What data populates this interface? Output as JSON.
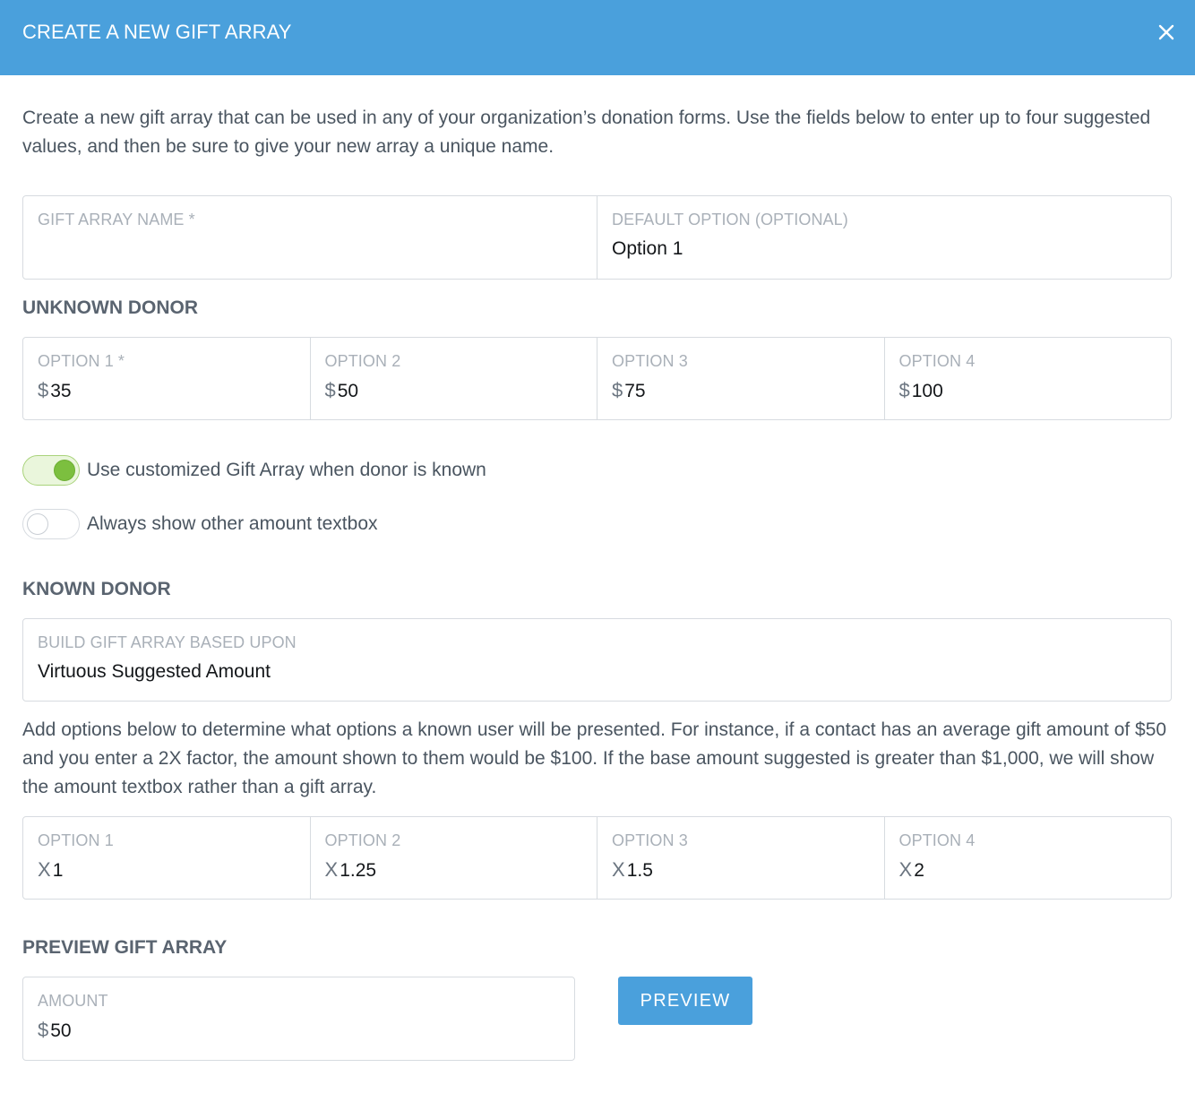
{
  "header": {
    "title": "CREATE A NEW GIFT ARRAY",
    "close_icon": "close-icon"
  },
  "intro": "Create a new gift array that can be used in any of your organization’s donation forms. Use the fields below to enter up to four suggested values, and then be sure to give your new array a unique name.",
  "array_fields": {
    "name_label": "GIFT ARRAY NAME *",
    "name_value": "",
    "default_label": "DEFAULT OPTION (OPTIONAL)",
    "default_value": "Option 1"
  },
  "unknown_donor": {
    "title": "UNKNOWN DONOR",
    "currency_symbol": "$",
    "options": [
      {
        "label": "OPTION 1 *",
        "value": "35"
      },
      {
        "label": "OPTION 2",
        "value": "50"
      },
      {
        "label": "OPTION 3",
        "value": "75"
      },
      {
        "label": "OPTION 4",
        "value": "100"
      }
    ]
  },
  "toggles": [
    {
      "label": "Use customized Gift Array when donor is known",
      "on": true
    },
    {
      "label": "Always show other amount textbox",
      "on": false
    }
  ],
  "known_donor": {
    "title": "KNOWN DONOR",
    "basis_label": "BUILD GIFT ARRAY BASED UPON",
    "basis_value": "Virtuous Suggested Amount",
    "help": "Add options below to determine what options a known user will be presented. For instance, if a contact has an average gift amount of $50 and you enter a 2X factor, the amount shown to them would be $100. If the base amount suggested is greater than $1,000, we will show the amount textbox rather than a gift array.",
    "multiplier_symbol": "X",
    "options": [
      {
        "label": "OPTION 1",
        "value": "1"
      },
      {
        "label": "OPTION 2",
        "value": "1.25"
      },
      {
        "label": "OPTION 3",
        "value": "1.5"
      },
      {
        "label": "OPTION 4",
        "value": "2"
      }
    ]
  },
  "preview": {
    "title": "PREVIEW GIFT ARRAY",
    "amount_label": "AMOUNT",
    "currency_symbol": "$",
    "amount_value": "50",
    "button_label": "PREVIEW"
  },
  "colors": {
    "header_bg": "#4aa0dc",
    "toggle_on": "#7cbf3f",
    "button_bg": "#4aa0dc"
  }
}
